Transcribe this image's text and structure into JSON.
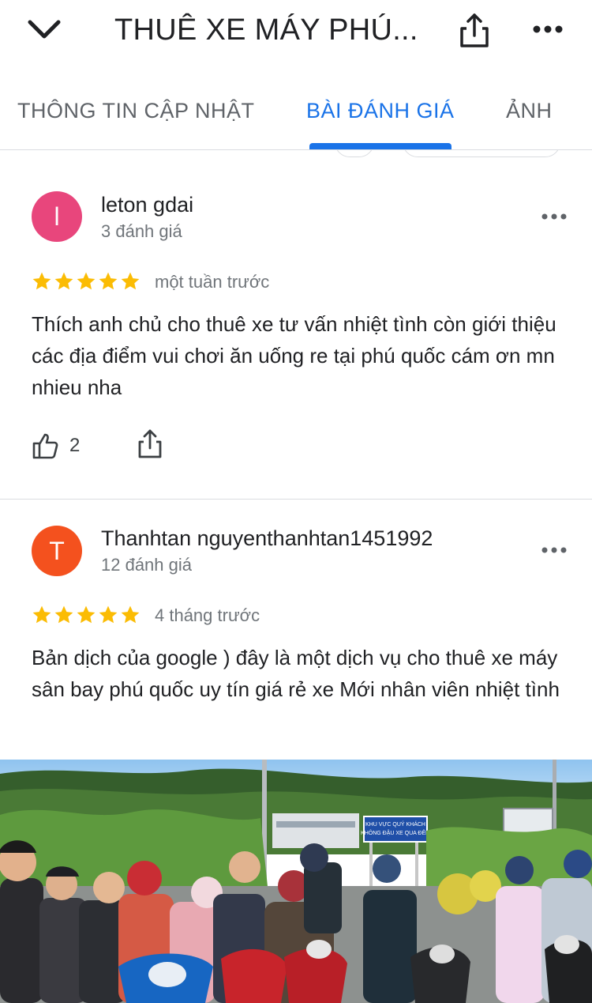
{
  "header": {
    "title": "THUÊ XE MÁY PHÚ...",
    "back_icon": "chevron-down-icon",
    "share_icon": "share-icon",
    "more_icon": "more-horiz-icon"
  },
  "tabs": [
    {
      "label": "THÔNG TIN CẬP NHẬT",
      "active": false
    },
    {
      "label": "BÀI ĐÁNH GIÁ",
      "active": true
    },
    {
      "label": "ẢNH",
      "active": false
    }
  ],
  "colors": {
    "accent": "#1a73e8",
    "star": "#fbbc04",
    "avatar_leton": "#e8467c",
    "avatar_thanhtan": "#f4511e"
  },
  "reviews": [
    {
      "avatar_letter": "l",
      "author": "leton gdai",
      "review_count": "3 đánh giá",
      "rating": 5,
      "time": "một tuần trước",
      "text": "Thích anh chủ cho thuê xe tư vấn nhiệt tình còn giới thiệu các địa điểm vui chơi ăn uống re tại phú quốc cám ơn mn nhieu  nha",
      "likes": "2"
    },
    {
      "avatar_letter": "T",
      "author": "Thanhtan nguyenthanhtan1451992",
      "review_count": "12 đánh giá",
      "rating": 5,
      "time": "4 tháng trước",
      "text": "Bản dịch của google ) đây là một dịch vụ cho thuê xe máy sân bay phú quốc uy tín giá rẻ xe Mới nhân viên nhiệt tình"
    }
  ],
  "photo": {
    "sign_line1": "KHU VỰC QUÝ KHÁCH",
    "sign_line2": "KHÔNG ĐẬU XE QUA ĐÊM"
  }
}
